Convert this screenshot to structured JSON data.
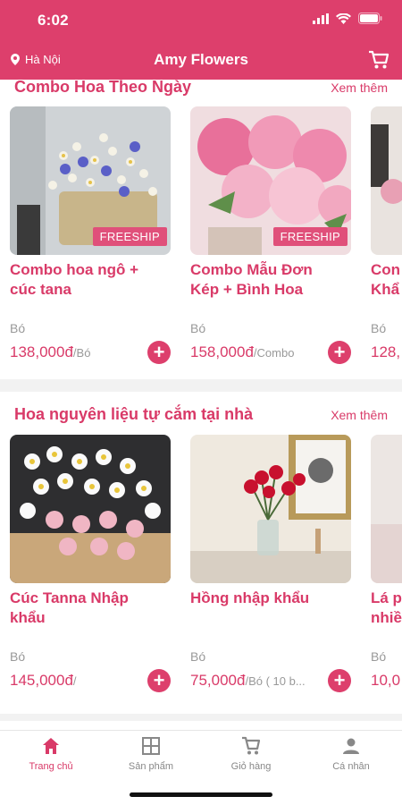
{
  "status": {
    "time": "6:02"
  },
  "header": {
    "location": "Hà Nội",
    "title": "Amy Flowers"
  },
  "sections": [
    {
      "title": "Combo Hoa Theo Ngày",
      "see_more": "Xem thêm",
      "cards": [
        {
          "name_line1": "Combo hoa ngô +",
          "name_line2": "cúc tana",
          "unit": "Bó",
          "price": "138,000đ",
          "price_unit": "/Bó",
          "badge": "FREESHIP"
        },
        {
          "name_line1": "Combo Mẫu Đơn",
          "name_line2": "Kép + Bình Hoa",
          "unit": "Bó",
          "price": "158,000đ",
          "price_unit": "/Combo",
          "badge": "FREESHIP"
        },
        {
          "name_line1": "Con",
          "name_line2": "Khẩ",
          "unit": "Bó",
          "price": "128,",
          "price_unit": ""
        }
      ]
    },
    {
      "title": "Hoa nguyên liệu tự cắm tại nhà",
      "see_more": "Xem thêm",
      "cards": [
        {
          "name_line1": "Cúc Tanna Nhập",
          "name_line2": "khẩu",
          "unit": "Bó",
          "price": "145,000đ",
          "price_unit": "/"
        },
        {
          "name_line1": "Hồng nhập khẩu",
          "name_line2": "",
          "unit": "Bó",
          "price": "75,000đ",
          "price_unit": "/Bó ( 10 b..."
        },
        {
          "name_line1": "Lá p",
          "name_line2": "nhiề",
          "unit": "Bó",
          "price": "10,0",
          "price_unit": ""
        }
      ]
    }
  ],
  "bottom_nav": [
    {
      "label": "Trang chủ",
      "icon": "home-icon",
      "active": true
    },
    {
      "label": "Sản phẩm",
      "icon": "grid-icon",
      "active": false
    },
    {
      "label": "Giỏ hàng",
      "icon": "cart-icon",
      "active": false
    },
    {
      "label": "Cá nhân",
      "icon": "person-icon",
      "active": false
    }
  ],
  "colors": {
    "brand": "#dd3f6c",
    "text_accent": "#d93a68",
    "muted": "#999999"
  }
}
